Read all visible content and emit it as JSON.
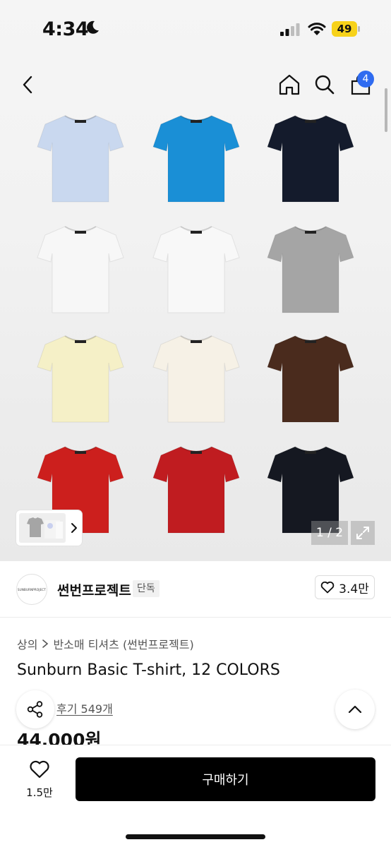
{
  "status": {
    "time": "4:34",
    "battery": "49"
  },
  "nav": {
    "cart_count": "4",
    "icons": [
      "back-icon",
      "home-icon",
      "search-icon",
      "cart-icon"
    ]
  },
  "gallery": {
    "pager": "1 / 2",
    "tee_colors": [
      "#c9d8ef",
      "#1a8fd6",
      "#141b2c",
      "#f7f7f7",
      "#f8f8f8",
      "#a5a5a5",
      "#f5f0c7",
      "#f6f1e6",
      "#4a2b1d",
      "#cc1f1d",
      "#c01c20",
      "#151821"
    ]
  },
  "brand": {
    "logo_text": "SUNBURNPROJECT",
    "name": "썬번프로젝트",
    "tag": "단독",
    "likes": "3.4만"
  },
  "product": {
    "breadcrumb": [
      "상의",
      "반소매 티셔츠 (썬번프로젝트)"
    ],
    "title": "Sunburn Basic T-shirt, 12 COLORS",
    "reviews": "후기 549개",
    "price": "44,000원"
  },
  "bottom": {
    "wish_count": "1.5만",
    "buy_label": "구매하기"
  }
}
